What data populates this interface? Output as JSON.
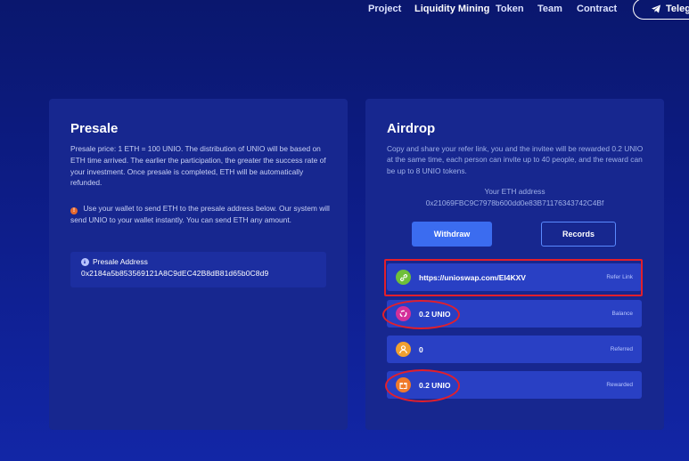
{
  "nav": {
    "items": [
      "Project",
      "Liquidity Mining",
      "Token",
      "Team",
      "Contract"
    ],
    "telegram_label": "Telegr"
  },
  "presale": {
    "title": "Presale",
    "description": "Presale price: 1 ETH = 100 UNIO. The distribution of UNIO will be based on ETH time arrived. The earlier the participation, the greater the success rate of your investment. Once presale is completed, ETH will be automatically refunded.",
    "note": "Use your wallet to send ETH to the presale address below. Our system will send UNIO to your wallet instantly. You can send ETH any amount.",
    "address_label": "Presale Address",
    "address_value": "0x2184a5b853569121A8C9dEC42B8dB81d65b0C8d9"
  },
  "airdrop": {
    "title": "Airdrop",
    "description": "Copy and share your refer link, you and the invitee will be rewarded 0.2 UNIO at the same time, each person can invite up to 40 people, and the reward can be up to 8 UNIO tokens.",
    "eth_address_label": "Your ETH address",
    "eth_address_value": "0x21069FBC9C7978b600dd0e83B71176343742C4Bf",
    "withdraw_label": "Withdraw",
    "records_label": "Records",
    "rows": [
      {
        "icon": "link-icon",
        "value": "https://unioswap.com/EI4KXV",
        "tag": "Refer Link",
        "color": "#6fbf3a"
      },
      {
        "icon": "balance-icon",
        "value": "0.2 UNIO",
        "tag": "Balance",
        "color": "#d3309a"
      },
      {
        "icon": "person-icon",
        "value": "0",
        "tag": "Referred",
        "color": "#f0a030"
      },
      {
        "icon": "gift-icon",
        "value": "0.2 UNIO",
        "tag": "Rewarded",
        "color": "#f07a2a"
      }
    ]
  },
  "colors": {
    "background": "#0d1a7a",
    "card": "#17278f",
    "row": "#2940c4",
    "accent": "#3b6cf0",
    "highlight": "#e21f2b"
  }
}
